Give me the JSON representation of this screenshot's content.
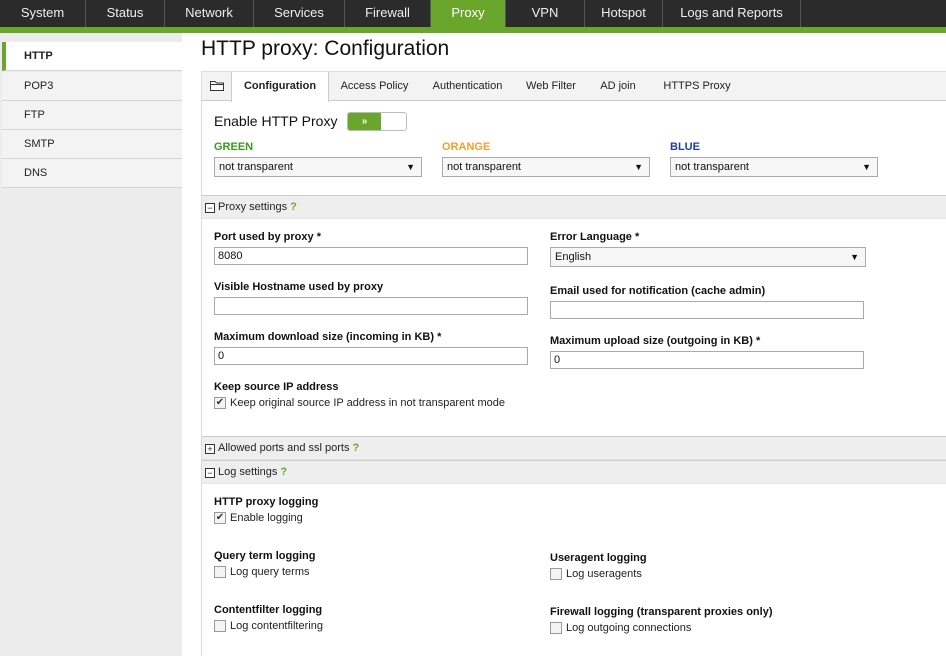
{
  "topnav": {
    "tabs": [
      {
        "label": "System",
        "active": false
      },
      {
        "label": "Status",
        "active": false
      },
      {
        "label": "Network",
        "active": false
      },
      {
        "label": "Services",
        "active": false
      },
      {
        "label": "Firewall",
        "active": false
      },
      {
        "label": "Proxy",
        "active": true
      },
      {
        "label": "VPN",
        "active": false
      },
      {
        "label": "Hotspot",
        "active": false
      },
      {
        "label": "Logs and Reports",
        "active": false
      }
    ]
  },
  "sidebar": {
    "items": [
      {
        "label": "HTTP",
        "active": true
      },
      {
        "label": "POP3",
        "active": false
      },
      {
        "label": "FTP",
        "active": false
      },
      {
        "label": "SMTP",
        "active": false
      },
      {
        "label": "DNS",
        "active": false
      }
    ]
  },
  "page_title": "HTTP proxy: Configuration",
  "form_tabs": [
    {
      "label": "Configuration",
      "active": true
    },
    {
      "label": "Access Policy",
      "active": false
    },
    {
      "label": "Authentication",
      "active": false
    },
    {
      "label": "Web Filter",
      "active": false
    },
    {
      "label": "AD join",
      "active": false
    },
    {
      "label": "HTTPS Proxy",
      "active": false
    }
  ],
  "enable": {
    "label": "Enable HTTP Proxy",
    "toggle_text": "»",
    "enabled": true
  },
  "zones": [
    {
      "label": "GREEN",
      "color": "#3a9a1c",
      "value": "not transparent"
    },
    {
      "label": "ORANGE",
      "color": "#f0a030",
      "value": "not transparent"
    },
    {
      "label": "BLUE",
      "color": "#1f3f9f",
      "value": "not transparent"
    }
  ],
  "proxy_settings": {
    "heading": "Proxy settings",
    "help": "?",
    "port_label": "Port used by proxy *",
    "port_value": "8080",
    "hostname_label": "Visible Hostname used by proxy",
    "hostname_value": "",
    "maxdl_label": "Maximum download size (incoming in KB) *",
    "maxdl_value": "0",
    "keepip_label": "Keep source IP address",
    "keepip_checkbox": "Keep original source IP address in not transparent mode",
    "errlang_label": "Error Language *",
    "errlang_value": "English",
    "email_label": "Email used for notification (cache admin)",
    "email_value": "",
    "maxul_label": "Maximum upload size (outgoing in KB) *",
    "maxul_value": "0"
  },
  "allowed_ports": {
    "heading": "Allowed ports and ssl ports",
    "help": "?"
  },
  "log_settings": {
    "heading": "Log settings",
    "help": "?",
    "http_logging_label": "HTTP proxy logging",
    "enable_logging": "Enable logging",
    "query_label": "Query term logging",
    "query_checkbox": "Log query terms",
    "useragent_label": "Useragent logging",
    "useragent_checkbox": "Log useragents",
    "contentfilter_label": "Contentfilter logging",
    "contentfilter_checkbox": "Log contentfiltering",
    "firewall_label": "Firewall logging (transparent proxies only)",
    "firewall_checkbox": "Log outgoing connections"
  }
}
